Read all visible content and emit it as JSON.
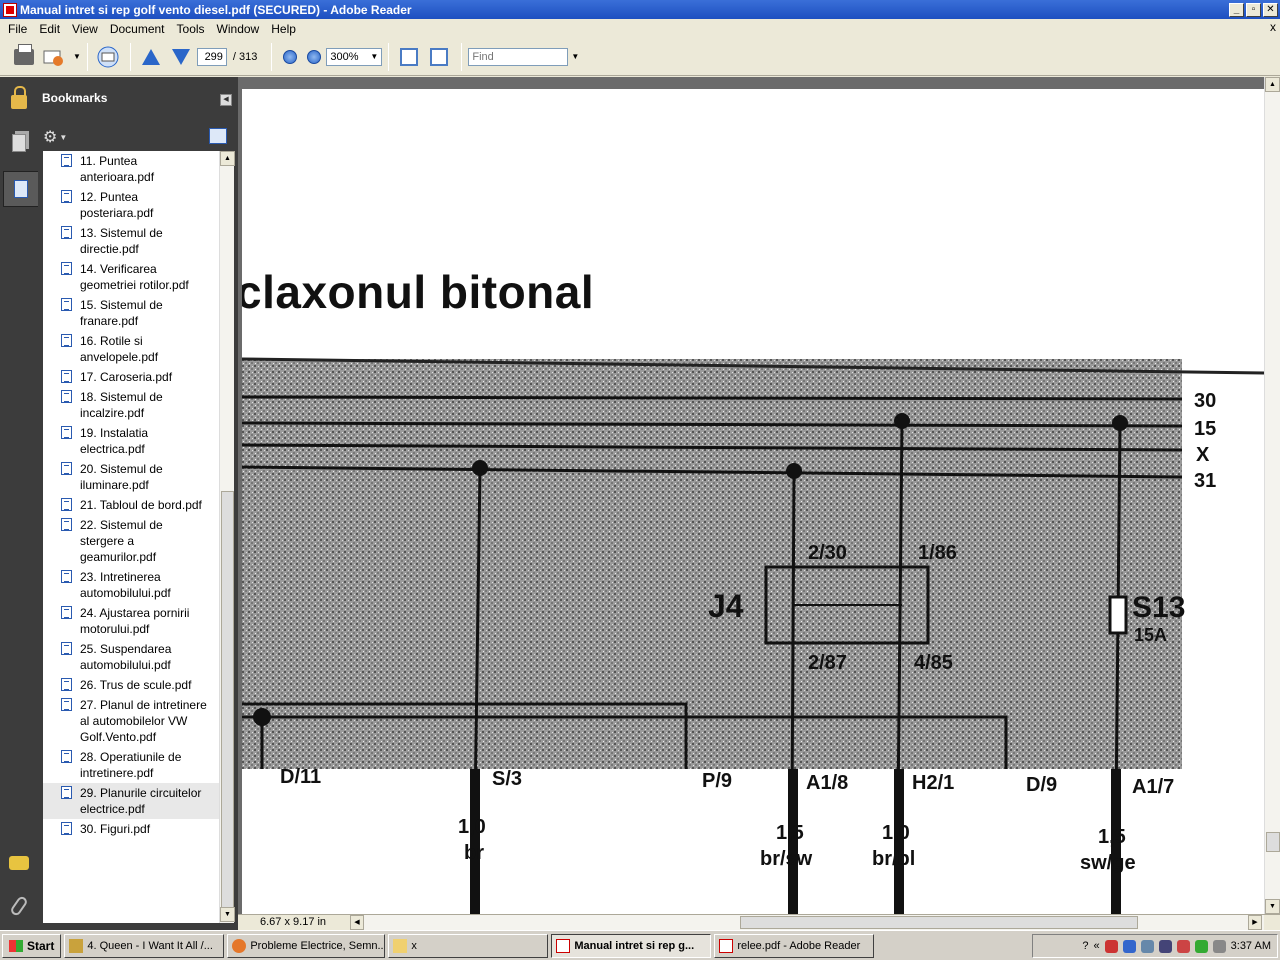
{
  "window": {
    "title": "Manual intret si rep golf vento diesel.pdf (SECURED) - Adobe Reader",
    "buttons": [
      "_",
      "▫",
      "✕"
    ]
  },
  "menu": {
    "items": [
      "File",
      "Edit",
      "View",
      "Document",
      "Tools",
      "Window",
      "Help"
    ],
    "close_glyph": "x"
  },
  "toolbar": {
    "page_current": "299",
    "page_total": "/ 313",
    "zoom": "300%",
    "find_placeholder": "Find"
  },
  "bookmarks": {
    "title": "Bookmarks",
    "items": [
      "11. Puntea anterioara.pdf",
      "12. Puntea posteriara.pdf",
      "13. Sistemul de directie.pdf",
      "14. Verificarea geometriei rotilor.pdf",
      "15. Sistemul de franare.pdf",
      "16. Rotile si anvelopele.pdf",
      "17. Caroseria.pdf",
      "18. Sistemul de incalzire.pdf",
      "19. Instalatia electrica.pdf",
      "20. Sistemul de iluminare.pdf",
      "21. Tabloul de bord.pdf",
      "22. Sistemul de stergere a geamurilor.pdf",
      "23. Intretinerea automobilului.pdf",
      "24. Ajustarea pornirii motorului.pdf",
      "25. Suspendarea automobilului.pdf",
      "26. Trus de scule.pdf",
      "27. Planul de intretinere al automobilelor VW Golf.Vento.pdf",
      "28. Operatiunile de intretinere.pdf",
      "29. Planurile circuitelor electrice.pdf",
      "30. Figuri.pdf"
    ],
    "selected_index": 18
  },
  "document": {
    "heading": "claxonul bitonal",
    "rails": [
      "30",
      "15",
      "X",
      "31"
    ],
    "component_J": "J4",
    "component_S": "S13",
    "fuse_rating": "15A",
    "relay_pins": [
      "2/30",
      "1/86",
      "2/87",
      "4/85"
    ],
    "connectors": [
      "D/11",
      "S/3",
      "P/9",
      "A1/8",
      "H2/1",
      "D/9",
      "A1/7"
    ],
    "wires": [
      {
        "size": "1,0",
        "color": "br"
      },
      {
        "size": "1,5",
        "color": "br/sw"
      },
      {
        "size": "1,0",
        "color": "br/bl"
      },
      {
        "size": "1,5",
        "color": "sw/ge"
      }
    ]
  },
  "status": {
    "page_size": "6.67 x 9.17 in"
  },
  "taskbar": {
    "start": "Start",
    "tasks": [
      "4. Queen - I Want It All /...",
      "Probleme Electrice, Semn...",
      "x",
      "Manual intret si rep g...",
      "relee.pdf - Adobe Reader"
    ],
    "active_index": 3,
    "tray_help": "?",
    "tray_expand": "«",
    "clock": "3:37 AM"
  }
}
